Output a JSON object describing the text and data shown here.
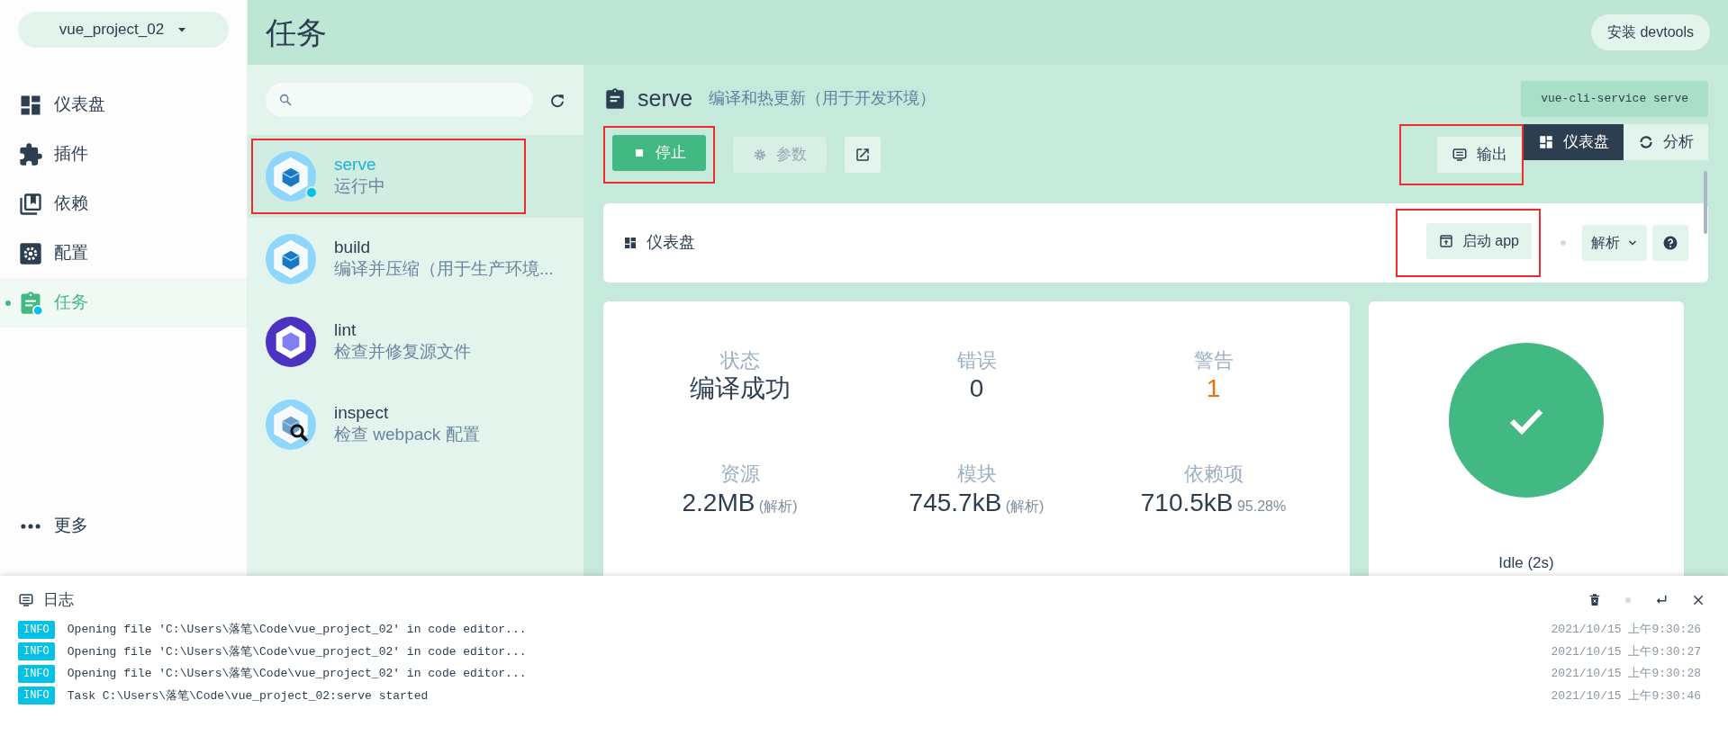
{
  "project_selector": {
    "label": "vue_project_02"
  },
  "nav": {
    "items": [
      {
        "label": "仪表盘",
        "kind": "dashboard",
        "selected": false
      },
      {
        "label": "插件",
        "kind": "plugins",
        "selected": false
      },
      {
        "label": "依赖",
        "kind": "dependencies",
        "selected": false
      },
      {
        "label": "配置",
        "kind": "config",
        "selected": false
      },
      {
        "label": "任务",
        "kind": "tasks",
        "selected": true
      }
    ],
    "more": "更多"
  },
  "page_title": "任务",
  "header_button": "安装 devtools",
  "task_list": {
    "tasks": [
      {
        "name": "serve",
        "description": "运行中",
        "kind": "webpack",
        "selected": true,
        "running": true,
        "highlighted": true
      },
      {
        "name": "build",
        "description": "编译并压缩（用于生产环境...",
        "kind": "webpack",
        "selected": false,
        "running": false,
        "highlighted": false
      },
      {
        "name": "lint",
        "description": "检查并修复源文件",
        "kind": "eslint",
        "selected": false,
        "running": false,
        "highlighted": false
      },
      {
        "name": "inspect",
        "description": "检查 webpack 配置",
        "kind": "inspect",
        "selected": false,
        "running": false,
        "highlighted": false
      }
    ]
  },
  "task": {
    "name": "serve",
    "description": "编译和热更新（用于开发环境）",
    "command": "vue-cli-service serve",
    "actions": [
      {
        "label": "停止",
        "kind": "stop",
        "disabled": false,
        "highlighted": true
      },
      {
        "label": "参数",
        "kind": "params",
        "disabled": true,
        "highlighted": false
      }
    ],
    "views": [
      {
        "label": "输出",
        "kind": "output",
        "selected": false,
        "highlighted": true
      },
      {
        "label": "仪表盘",
        "kind": "dashboard",
        "selected": true,
        "highlighted": false
      },
      {
        "label": "分析",
        "kind": "analyze",
        "selected": false,
        "highlighted": false
      }
    ]
  },
  "dashboard": {
    "title": "仪表盘",
    "launch_button": {
      "label": "启动 app",
      "highlighted": true
    },
    "mode_select": {
      "label": "解析"
    },
    "stats": [
      {
        "label": "状态",
        "value": "编译成功",
        "kind": "normal"
      },
      {
        "label": "错误",
        "value": "0",
        "kind": "normal"
      },
      {
        "label": "警告",
        "value": "1",
        "kind": "warning"
      },
      {
        "label": "资源",
        "value": "2.2MB",
        "note": "(解析)",
        "kind": "normal"
      },
      {
        "label": "模块",
        "value": "745.7kB",
        "note": "(解析)",
        "kind": "normal"
      },
      {
        "label": "依赖项",
        "value": "710.5kB",
        "note": "95.28%",
        "kind": "normal"
      }
    ],
    "status": {
      "kind": "success",
      "label": "Idle (2s)"
    }
  },
  "log": {
    "title": "日志",
    "entries": [
      {
        "level": "INFO",
        "message": "Opening file 'C:\\Users\\落笔\\Code\\vue_project_02' in code editor...",
        "time": "2021/10/15 上午9:30:26"
      },
      {
        "level": "INFO",
        "message": "Opening file 'C:\\Users\\落笔\\Code\\vue_project_02' in code editor...",
        "time": "2021/10/15 上午9:30:27"
      },
      {
        "level": "INFO",
        "message": "Opening file 'C:\\Users\\落笔\\Code\\vue_project_02' in code editor...",
        "time": "2021/10/15 上午9:30:28"
      },
      {
        "level": "INFO",
        "message": "Task C:\\Users\\落笔\\Code\\vue_project_02:serve started",
        "time": "2021/10/15 上午9:30:46"
      }
    ]
  }
}
